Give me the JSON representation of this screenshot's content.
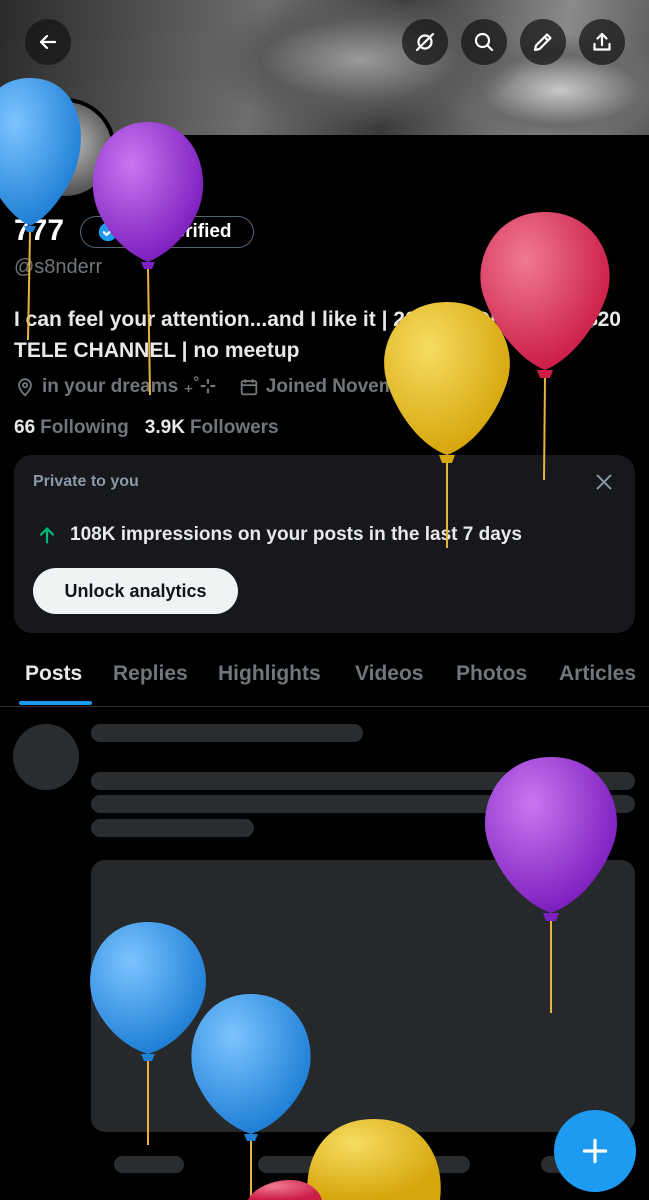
{
  "profile": {
    "display_name": "777",
    "verify_label": "Get verified",
    "handle": "@s8nderr",
    "bio": "I can feel your attention...and I like it | 20 | $15 DM FEES | $20 TELE CHANNEL | no meetup",
    "location": "in your dreams ₊˚⊹",
    "joined": "Joined November 2024",
    "following_count": "66",
    "following_label": "Following",
    "followers_count": "3.9K",
    "followers_label": "Followers"
  },
  "private_card": {
    "heading": "Private to you",
    "impressions": "108K impressions on your posts in the last 7 days",
    "unlock_label": "Unlock analytics"
  },
  "tabs": [
    "Posts",
    "Replies",
    "Highlights",
    "Videos",
    "Photos",
    "Articles"
  ],
  "active_tab": "Posts",
  "icons": {
    "back": "arrow-left-icon",
    "fleet": "no-signal-icon",
    "search": "search-icon",
    "edit": "pencil-icon",
    "share": "share-icon",
    "verified": "verified-badge-icon",
    "location": "location-pin-icon",
    "calendar": "calendar-icon",
    "up_arrow": "arrow-up-icon",
    "close": "close-icon",
    "compose": "plus-icon"
  },
  "colors": {
    "accent": "#1d9bf0",
    "impressions_arrow": "#00ba7c",
    "balloon_blue": "#3a9be6",
    "balloon_purple": "#9b2fd0",
    "balloon_yellow": "#e8bf1c",
    "balloon_red": "#e23a5e"
  }
}
